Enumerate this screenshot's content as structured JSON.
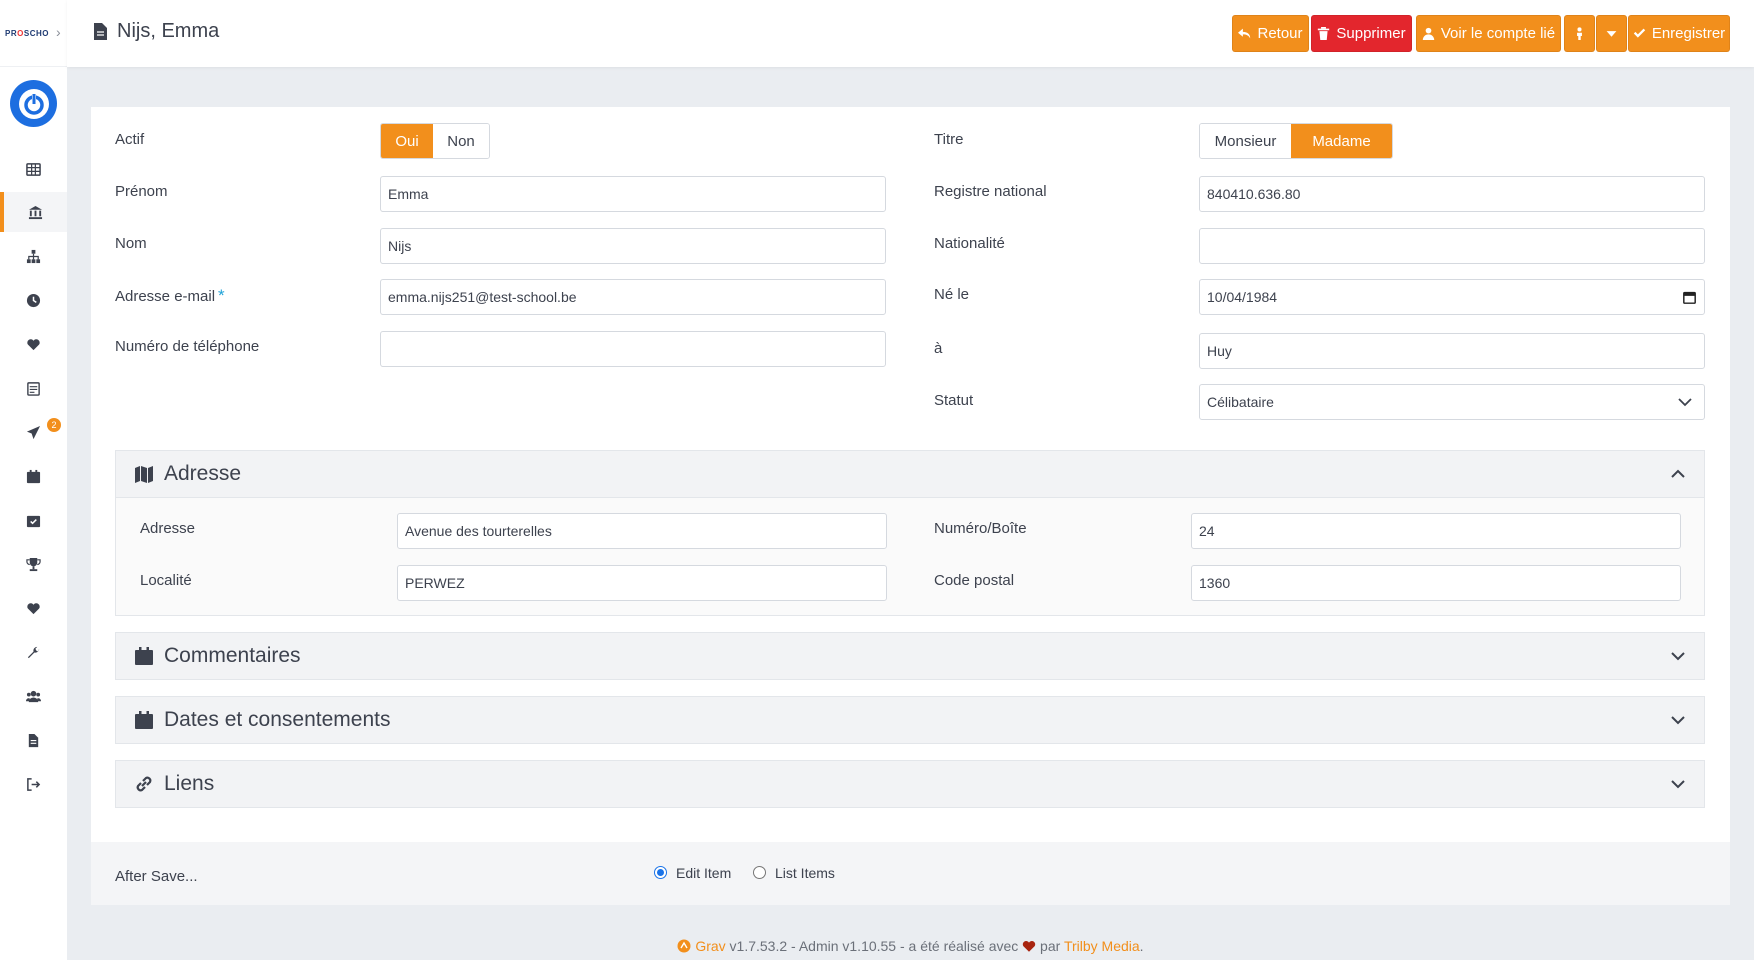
{
  "sidebar": {
    "logo_text": "PROSCHOOL",
    "toggle": "›",
    "items": [
      {
        "name": "dashboard",
        "icon": "grid-icon"
      },
      {
        "name": "school",
        "icon": "bank-icon",
        "active": true
      },
      {
        "name": "structure",
        "icon": "sitemap-icon"
      },
      {
        "name": "history",
        "icon": "clock-icon"
      },
      {
        "name": "favorites",
        "icon": "heart-icon"
      },
      {
        "name": "calendar-list",
        "icon": "calendar-list-icon"
      },
      {
        "name": "messages",
        "icon": "paper-plane-icon",
        "badge": "2"
      },
      {
        "name": "agenda",
        "icon": "calendar-icon"
      },
      {
        "name": "tasks",
        "icon": "calendar-check-icon"
      },
      {
        "name": "awards",
        "icon": "trophy-icon"
      },
      {
        "name": "likes",
        "icon": "heart-icon"
      },
      {
        "name": "tools",
        "icon": "wrench-icon"
      },
      {
        "name": "users",
        "icon": "users-icon"
      },
      {
        "name": "documents",
        "icon": "file-icon"
      },
      {
        "name": "logout",
        "icon": "sign-out-icon"
      }
    ]
  },
  "header": {
    "title": "Nijs, Emma",
    "buttons": {
      "back": "Retour",
      "delete": "Supprimer",
      "linked_account": "Voir le compte lié",
      "save": "Enregistrer"
    }
  },
  "form": {
    "left": {
      "active_label": "Actif",
      "active_options": [
        "Oui",
        "Non"
      ],
      "active_selected": "Oui",
      "firstname_label": "Prénom",
      "firstname_value": "Emma",
      "lastname_label": "Nom",
      "lastname_value": "Nijs",
      "email_label": "Adresse e-mail",
      "email_required": "*",
      "email_value": "emma.nijs251@test-school.be",
      "phone_label": "Numéro de téléphone",
      "phone_value": ""
    },
    "right": {
      "title_label": "Titre",
      "title_options": [
        "Monsieur",
        "Madame"
      ],
      "title_selected": "Madame",
      "national_register_label": "Registre national",
      "national_register_value": "840410.636.80",
      "nationality_label": "Nationalité",
      "nationality_value": "",
      "birth_label": "Né le",
      "birth_value": "10/04/1984",
      "birthplace_label": "à",
      "birthplace_value": "Huy",
      "status_label": "Statut",
      "status_value": "Célibataire"
    }
  },
  "address": {
    "title": "Adresse",
    "street_label": "Adresse",
    "street_value": "Avenue des tourterelles",
    "number_label": "Numéro/Boîte",
    "number_value": "24",
    "city_label": "Localité",
    "city_value": "PERWEZ",
    "zip_label": "Code postal",
    "zip_value": "1360"
  },
  "sections": {
    "comments": "Commentaires",
    "dates": "Dates et consentements",
    "links": "Liens"
  },
  "after_save": {
    "label": "After Save...",
    "options": [
      "Edit Item",
      "List Items"
    ],
    "selected": "Edit Item"
  },
  "footer": {
    "grav": "Grav",
    "text": " v1.7.53.2 - Admin v1.10.55 - a été réalisé avec ",
    "by": " par ",
    "trilby": "Trilby Media",
    "end": "."
  },
  "colors": {
    "accent": "#f28f1c",
    "danger": "#e3262d",
    "brand_blue": "#1d6ee0"
  }
}
